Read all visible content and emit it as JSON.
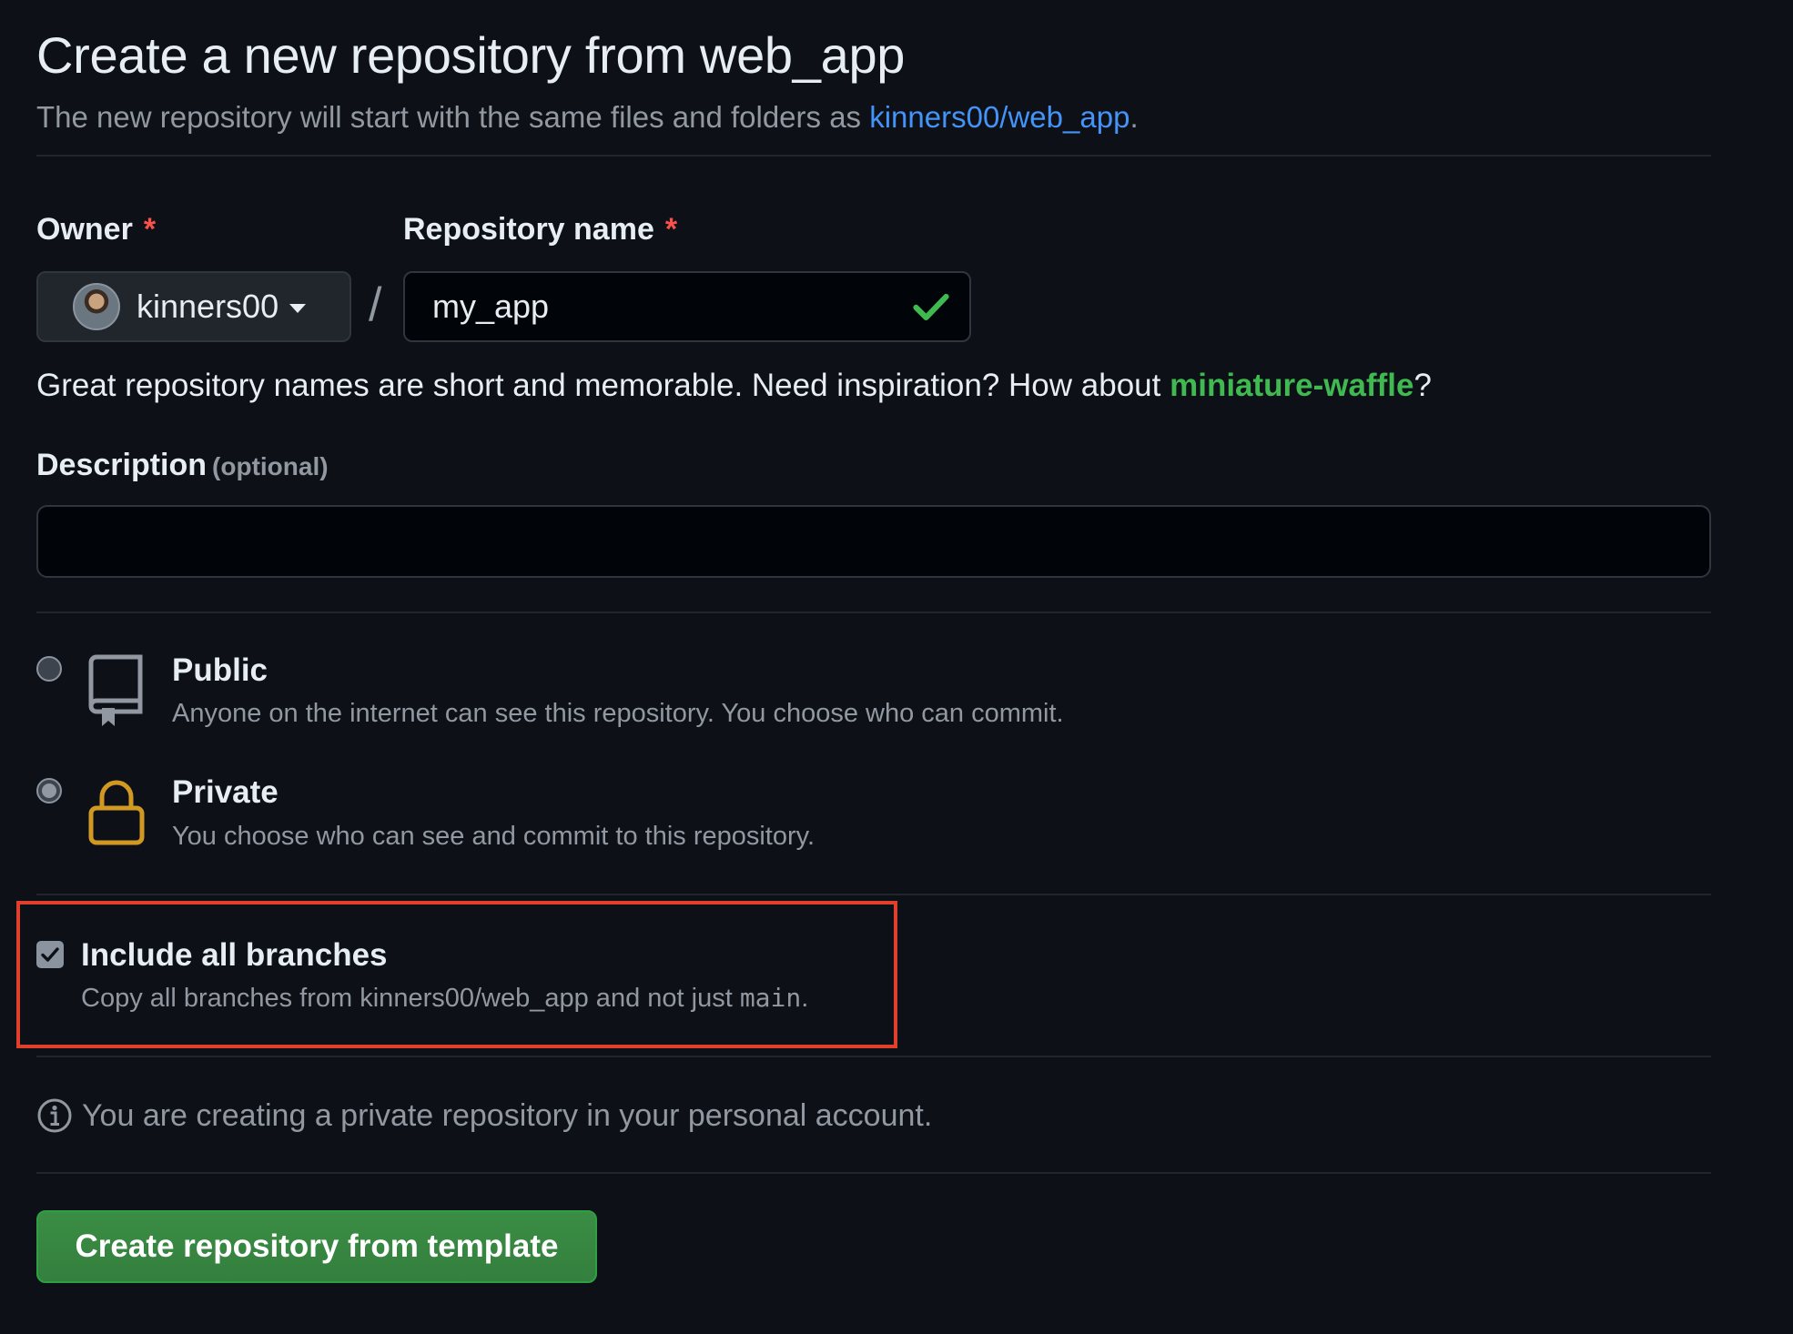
{
  "header": {
    "title": "Create a new repository from web_app",
    "subtitle_prefix": "The new repository will start with the same files and folders as ",
    "template_link": "kinners00/web_app",
    "subtitle_suffix": "."
  },
  "owner": {
    "label": "Owner",
    "required_mark": "*",
    "selected": "kinners00"
  },
  "separator": "/",
  "repository": {
    "label": "Repository name",
    "required_mark": "*",
    "value": "my_app",
    "valid": true
  },
  "name_hint": {
    "prefix": "Great repository names are short and memorable. Need inspiration? How about ",
    "suggestion": "miniature-waffle",
    "suffix": "?"
  },
  "description": {
    "label": "Description",
    "optional_label": "(optional)",
    "value": ""
  },
  "visibility": {
    "options": [
      {
        "title": "Public",
        "description": "Anyone on the internet can see this repository. You choose who can commit.",
        "icon": "repo-icon",
        "selected": false
      },
      {
        "title": "Private",
        "description": "You choose who can see and commit to this repository.",
        "icon": "lock-icon",
        "selected": true
      }
    ]
  },
  "branches": {
    "label": "Include all branches",
    "description_prefix": "Copy all branches from kinners00/web_app and not just ",
    "branch": "main",
    "description_suffix": ".",
    "checked": true
  },
  "info": {
    "icon": "info-icon",
    "text": "You are creating a private repository in your personal account."
  },
  "submit": {
    "label": "Create repository from template"
  },
  "colors": {
    "background": "#0d1117",
    "link": "#4493f8",
    "suggestion": "#3fb950",
    "required": "#f85149",
    "button": "#347f3e",
    "lock": "#d29922",
    "highlight_border": "#e0402b"
  }
}
